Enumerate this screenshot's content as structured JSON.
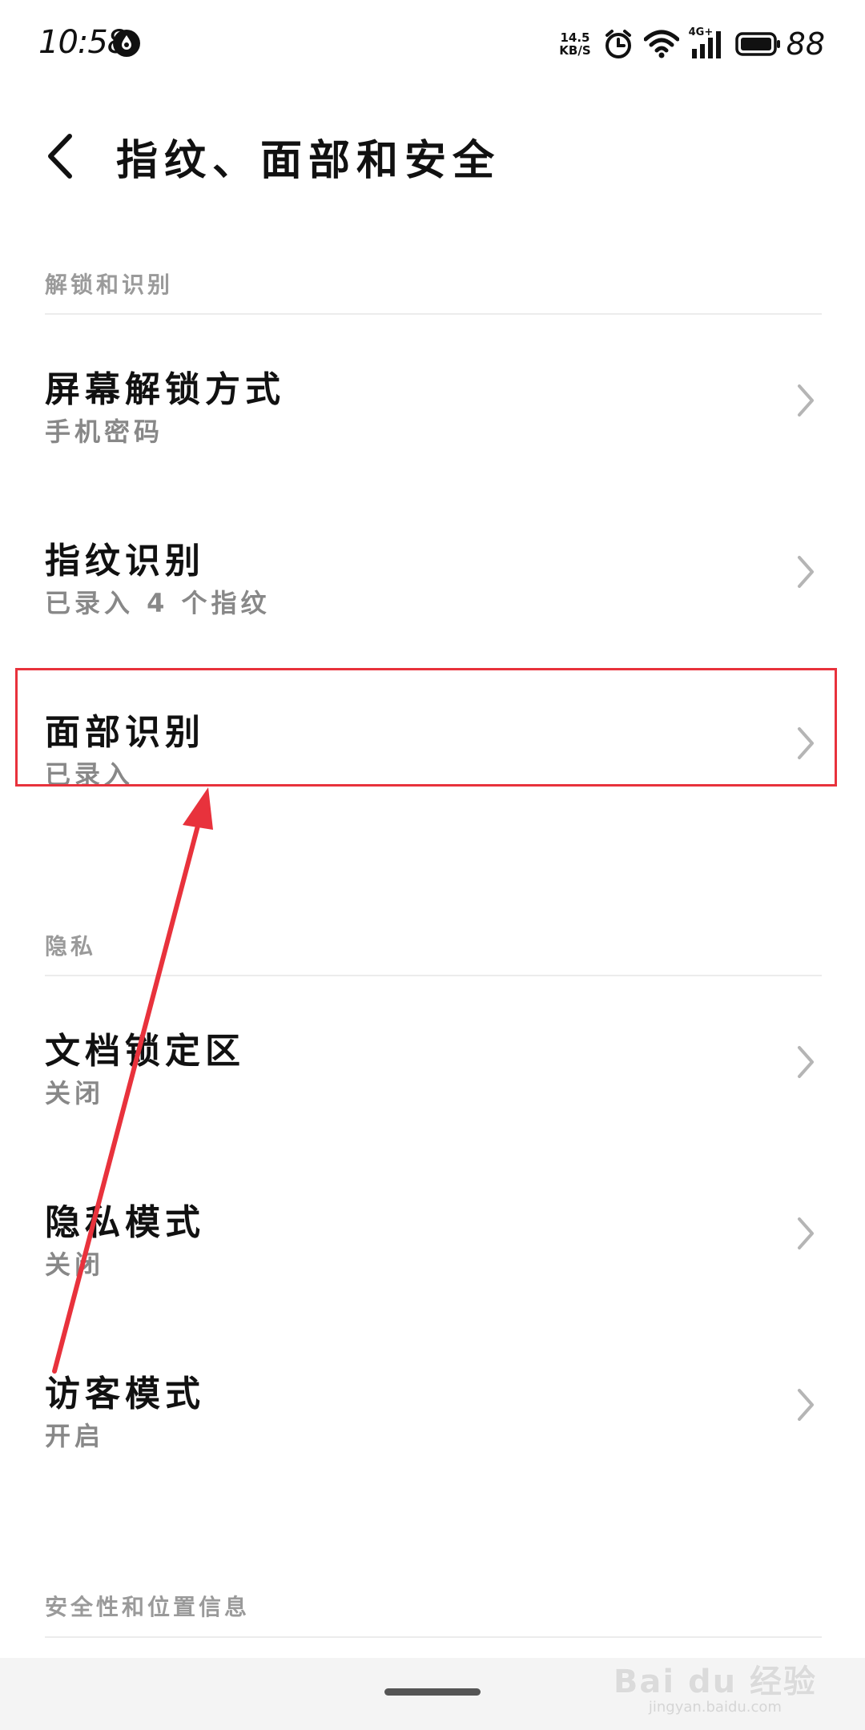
{
  "status_bar": {
    "time": "10:58",
    "net_speed_value": "14.5",
    "net_speed_unit": "KB/S",
    "network_type": "4G+",
    "battery": "88"
  },
  "header": {
    "title": "指纹、面部和安全"
  },
  "sections": {
    "unlock": {
      "header": "解锁和识别",
      "items": [
        {
          "title": "屏幕解锁方式",
          "subtitle": "手机密码"
        },
        {
          "title": "指纹识别",
          "subtitle": "已录入 4 个指纹"
        },
        {
          "title": "面部识别",
          "subtitle": "已录入"
        }
      ]
    },
    "privacy": {
      "header": "隐私",
      "items": [
        {
          "title": "文档锁定区",
          "subtitle": "关闭"
        },
        {
          "title": "隐私模式",
          "subtitle": "关闭"
        },
        {
          "title": "访客模式",
          "subtitle": "开启"
        }
      ]
    },
    "location": {
      "header": "安全性和位置信息"
    }
  },
  "watermark": {
    "brand": "Bai du 经验",
    "url": "jingyan.baidu.com"
  },
  "colors": {
    "annotation": "#e8323c",
    "section_header": "#9a9a9a",
    "subtitle": "#888888",
    "chevron": "#b5b5b5"
  },
  "icons": {
    "back": "chevron-left-icon",
    "row_action": "chevron-right-icon",
    "notification": "water-drop-icon",
    "alarm": "alarm-clock-icon",
    "wifi": "wifi-icon",
    "signal": "cellular-signal-icon",
    "battery": "battery-icon"
  }
}
